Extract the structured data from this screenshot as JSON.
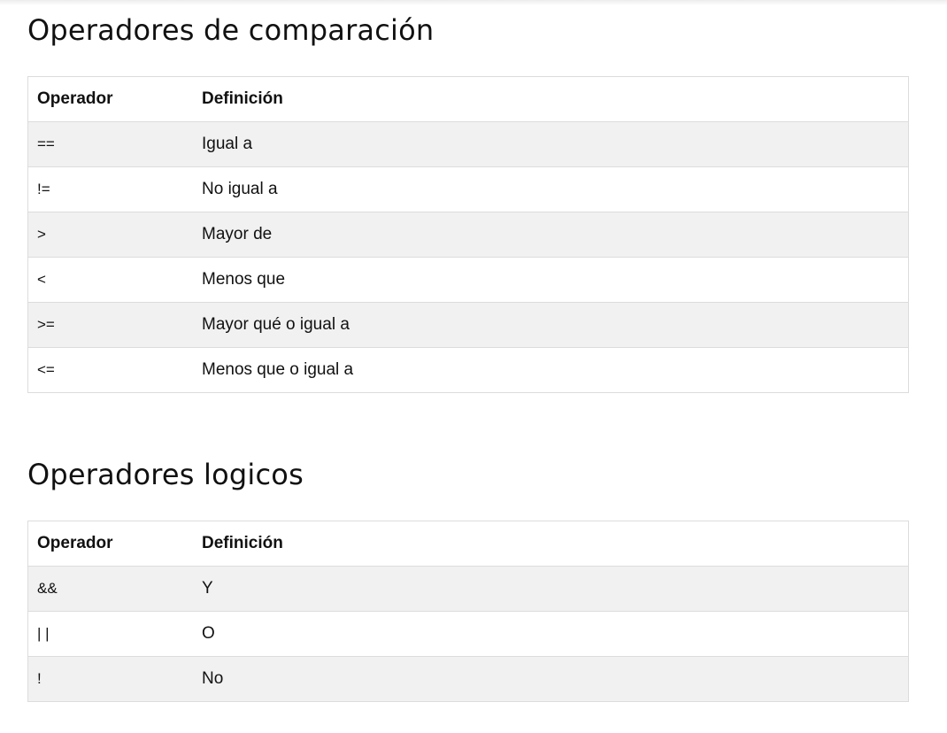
{
  "comparison": {
    "title": "Operadores de comparación",
    "headers": {
      "operator": "Operador",
      "definition": "Definición"
    },
    "rows": [
      {
        "operator": "==",
        "definition": "Igual a"
      },
      {
        "operator": "!=",
        "definition": "No igual a"
      },
      {
        "operator": ">",
        "definition": "Mayor de"
      },
      {
        "operator": "<",
        "definition": "Menos que"
      },
      {
        "operator": ">=",
        "definition": "Mayor qué o igual a"
      },
      {
        "operator": "<=",
        "definition": "Menos que o igual a"
      }
    ]
  },
  "logical": {
    "title": "Operadores logicos",
    "headers": {
      "operator": "Operador",
      "definition": "Definición"
    },
    "rows": [
      {
        "operator": "&&",
        "definition": "Y"
      },
      {
        "operator": "| |",
        "definition": "O"
      },
      {
        "operator": "!",
        "definition": "No"
      }
    ]
  },
  "colors": {
    "row_stripe": "#f1f1f1",
    "border": "#dcdcdc",
    "text": "#111111"
  }
}
